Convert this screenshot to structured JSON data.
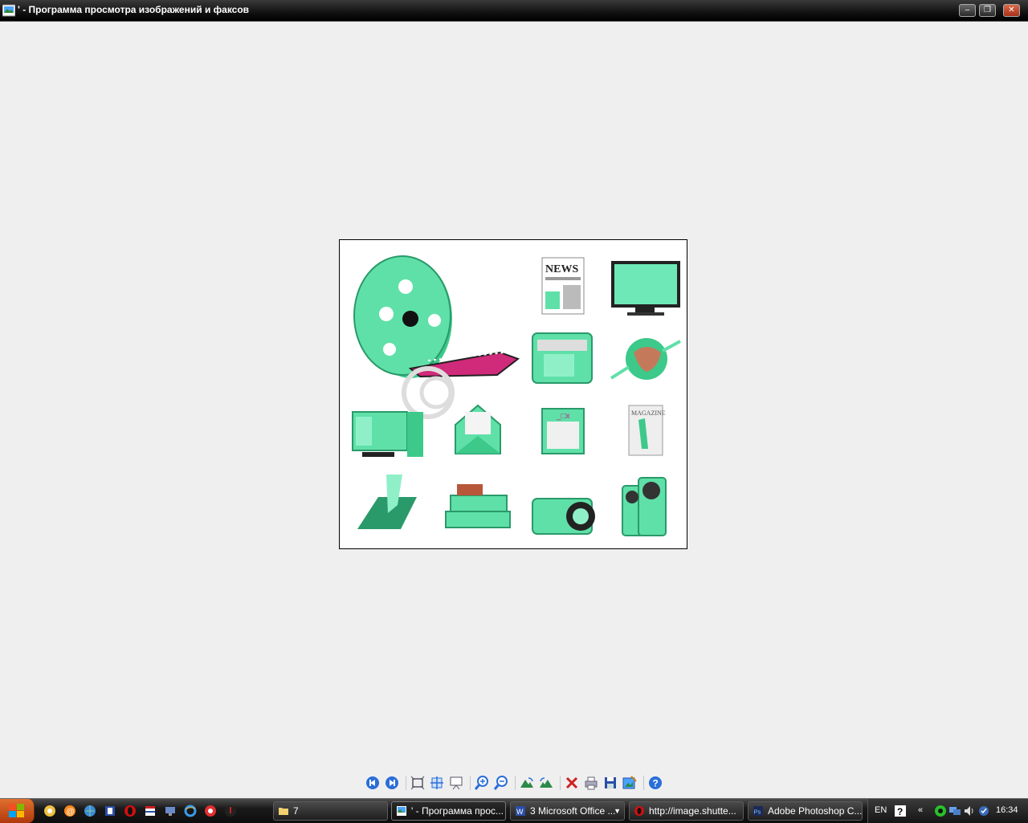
{
  "window": {
    "title": "' - Программа просмотра изображений и факсов",
    "minimize_glyph": "–",
    "maximize_glyph": "❐",
    "close_glyph": "✕"
  },
  "image": {
    "news_text": "NEWS",
    "magazine_text": "MAGAZINE"
  },
  "toolbar": {
    "buttons": [
      {
        "name": "previous-image-button",
        "icon": "previous-icon"
      },
      {
        "name": "next-image-button",
        "icon": "next-icon"
      },
      {
        "name": "best-fit-button",
        "icon": "best-fit-icon"
      },
      {
        "name": "actual-size-button",
        "icon": "actual-size-icon"
      },
      {
        "name": "slideshow-button",
        "icon": "slideshow-icon"
      },
      {
        "name": "zoom-in-button",
        "icon": "zoom-in-icon"
      },
      {
        "name": "zoom-out-button",
        "icon": "zoom-out-icon"
      },
      {
        "name": "rotate-clockwise-button",
        "icon": "rotate-cw-icon"
      },
      {
        "name": "rotate-counterclockwise-button",
        "icon": "rotate-ccw-icon"
      },
      {
        "name": "delete-button",
        "icon": "delete-icon"
      },
      {
        "name": "print-button",
        "icon": "print-icon"
      },
      {
        "name": "save-button",
        "icon": "save-icon"
      },
      {
        "name": "edit-button",
        "icon": "edit-icon"
      },
      {
        "name": "help-button",
        "icon": "help-icon"
      }
    ]
  },
  "taskbar": {
    "tasks": [
      {
        "label": "7"
      },
      {
        "label": "' - Программа прос..."
      },
      {
        "label": "3 Microsoft Office ..."
      },
      {
        "label": "http://image.shutte..."
      },
      {
        "label": "Adobe Photoshop C..."
      }
    ],
    "language": "EN",
    "chevron": "«",
    "clock": "16:34"
  },
  "colors": {
    "accent_green": "#5fe0a8",
    "dark_green": "#2a9a6a",
    "film_pink": "#d02a7a"
  }
}
